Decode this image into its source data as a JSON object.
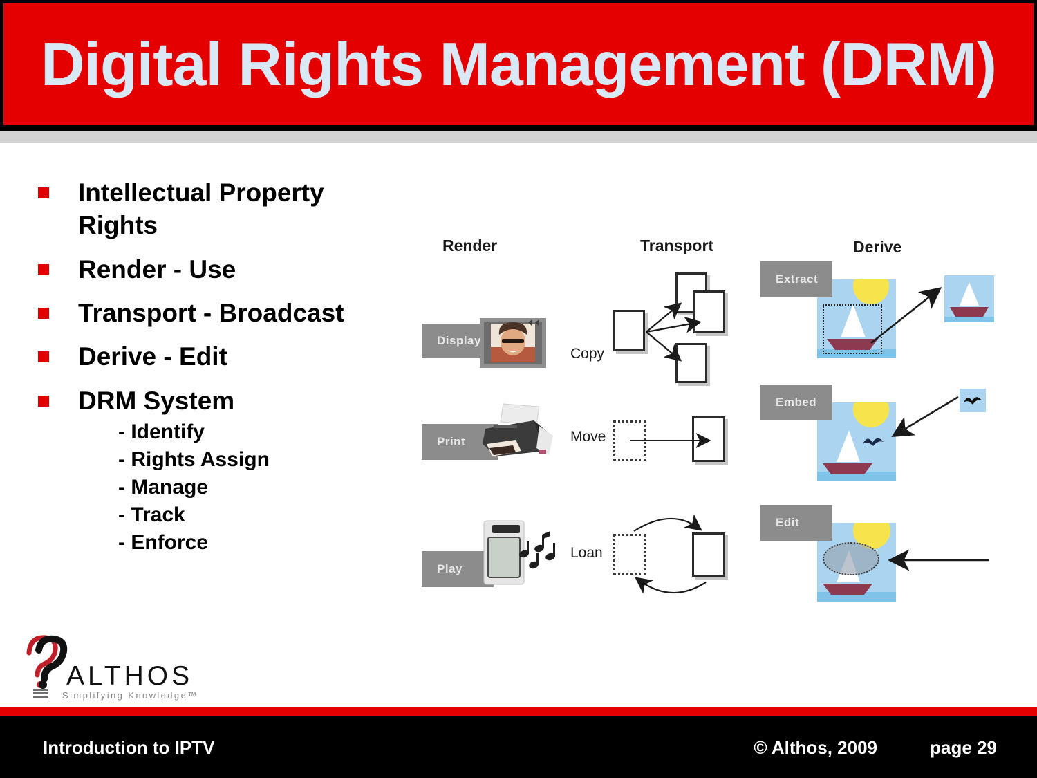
{
  "slide": {
    "title": "Digital Rights Management (DRM)",
    "title_color": "#d8e9f5",
    "header_color": "#e40000",
    "bullet_marker_color": "#e00000"
  },
  "bullets": [
    {
      "label": "Intellectual Property Rights",
      "subitems": []
    },
    {
      "label": "Render - Use",
      "subitems": []
    },
    {
      "label": "Transport - Broadcast",
      "subitems": []
    },
    {
      "label": "Derive - Edit",
      "subitems": []
    },
    {
      "label": "DRM System",
      "subitems": [
        "- Identify",
        "- Rights Assign",
        "- Manage",
        "- Track",
        "- Enforce"
      ]
    }
  ],
  "diagram": {
    "columns": [
      {
        "heading": "Render",
        "items": [
          "Display",
          "Print",
          "Play"
        ]
      },
      {
        "heading": "Transport",
        "items": [
          "Copy",
          "Move",
          "Loan"
        ]
      },
      {
        "heading": "Derive",
        "items": [
          "Extract",
          "Embed",
          "Edit"
        ]
      }
    ],
    "render": {
      "display_label": "Display",
      "print_label": "Print",
      "play_label": "Play"
    },
    "transport": {
      "copy_label": "Copy",
      "move_label": "Move",
      "loan_label": "Loan"
    },
    "derive": {
      "extract_label": "Extract",
      "embed_label": "Embed",
      "edit_label": "Edit"
    }
  },
  "logo": {
    "name": "ALTHOS",
    "tagline": "Simplifying Knowledge™"
  },
  "footer": {
    "left": "Introduction to IPTV",
    "copyright": "© Althos, 2009",
    "page": "page 29"
  }
}
